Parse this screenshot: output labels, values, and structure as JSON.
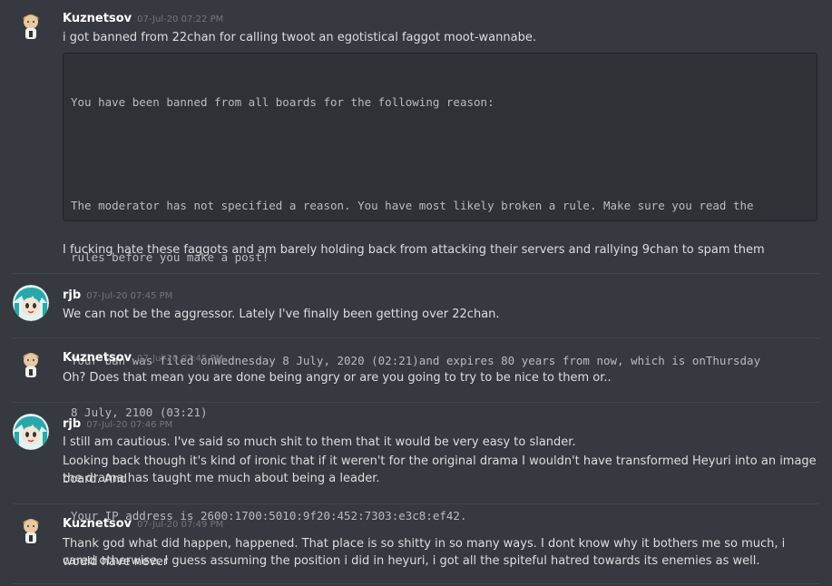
{
  "messages": [
    {
      "author": "Kuznetsov",
      "timestamp": "07-Jul-20 07:22 PM",
      "text": "i got banned from 22chan for calling twoot an egotistical faggot moot-wannabe.",
      "code": [
        "You have been banned from all boards for the following reason:",
        "",
        "The moderator has not specified a reason. You have most likely broken a rule. Make sure you read the",
        "rules before you make a post!",
        "",
        "Your ban was filed onWednesday 8 July, 2020 (02:21)and expires 80 years from now, which is onThursday",
        "8 July, 2100 (03:21)",
        "",
        "Your IP address is 2600:1700:5010:9f20:452:7303:e3c8:ef42."
      ],
      "followup": "I fucking hate these faggots and am barely holding back from attacking their servers and rallying 9chan to spam them"
    },
    {
      "author": "rjb",
      "timestamp": "07-Jul-20 07:45 PM",
      "text": "We can not be the aggressor. Lately I've finally been getting over 22chan."
    },
    {
      "author": "Kuznetsov",
      "timestamp": "07-Jul-20 07:45 PM",
      "text": "Oh? Does that mean you are done being angry or are you going to try to be nice to them or.."
    },
    {
      "author": "rjb",
      "timestamp": "07-Jul-20 07:46 PM",
      "text": "I still am cautious. I've said so much shit to them that it would be very easy to slander.",
      "followup_lines": [
        "Looking back though it's kind of ironic that if it weren't for the original drama I wouldn't have transformed Heyuri into an image board. And",
        "the drama has taught me much about being a leader."
      ]
    },
    {
      "author": "Kuznetsov",
      "timestamp": "07-Jul-20 07:49 PM",
      "text_lines": [
        "Thank god what did happen, happened. That place is so shitty in so many ways. I dont know why it bothers me so much, i would have never",
        "cared otherwise. I guess assuming the position i did in heyuri, i got all the spiteful hatred towards its enemies as well."
      ]
    }
  ],
  "colors": {
    "background": "#36393f",
    "author": "#ffffff",
    "timestamp": "#72767d",
    "text": "#dcddde",
    "code_bg": "#2f3136"
  },
  "icons": {
    "kuznetsov_avatar": "chibi-character-icon",
    "rjb_avatar": "teal-haired-character-icon"
  }
}
